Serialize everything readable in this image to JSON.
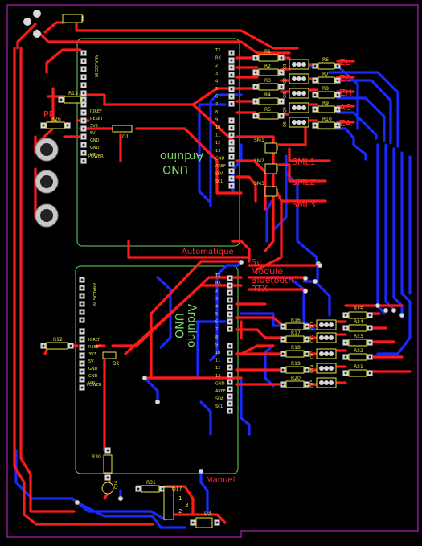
{
  "board": {
    "colors": {
      "background": "#000000",
      "outline": "#b020b0",
      "top_trace": "#ff1a1a",
      "bottom_trace": "#1a2aff",
      "silkscreen": "#e8e84a",
      "arduino_outline": "#5fd85a",
      "pad": "#d8d8d8"
    }
  },
  "labels": {
    "pr": "PR",
    "zl": "ZL",
    "zc": "ZC",
    "zh": "ZH",
    "ac": "AC",
    "za": "ZA",
    "sml1": "SML1",
    "sml2": "SML2",
    "sml3": "SML3",
    "automatique": "Automatique",
    "v5": "5v",
    "module": "Module",
    "bluetooth": "Bluetooth",
    "rtx": "RTX",
    "manuel": "Manuel"
  },
  "arduino_top": {
    "title_line1": "Arduino",
    "title_line2": "UNO",
    "pins_left": [
      "IOREF",
      "RESET",
      "3V3",
      "5V",
      "GND",
      "GND",
      "VIN"
    ],
    "pins_right": [
      "TX",
      "RX",
      "2",
      "3",
      "4",
      "5",
      "6",
      "7",
      "8",
      "9",
      "10",
      "11",
      "12",
      "13",
      "GND",
      "AREF",
      "SDA",
      "SCL"
    ],
    "analog": "ANALOG IN",
    "power": "POWER"
  },
  "arduino_bottom": {
    "title_line1": "Arduino",
    "title_line2": "UNO",
    "analog": "ANALOG IN",
    "power": "POWER"
  },
  "components": {
    "top_resistors": [
      "R1",
      "R2",
      "R3",
      "R4",
      "R5"
    ],
    "top_right_resistors": [
      "R6",
      "R7",
      "R8",
      "R9",
      "R10"
    ],
    "top_transistors": [
      "Q1",
      "Q2",
      "Q3",
      "Q4",
      "Q5"
    ],
    "switches": [
      "SM1",
      "SM2",
      "SM3"
    ],
    "bottom_resistors": [
      "R16",
      "R17",
      "R18",
      "R19",
      "R20"
    ],
    "bottom_right_resistors": [
      "R25",
      "R24",
      "R23",
      "R22",
      "R21"
    ],
    "bottom_transistors": [
      "Q11",
      "Q12",
      "Q13",
      "Q14",
      "Q15"
    ],
    "misc": {
      "r11": "R11",
      "r26": "R26",
      "r12": "R12",
      "r30": "R30",
      "r31": "R31",
      "d1": "D1",
      "d2": "D2",
      "d3": "D3",
      "q16": "Q16",
      "q17": "Q17",
      "n1": "1",
      "n2": "2",
      "n3": "3"
    }
  }
}
